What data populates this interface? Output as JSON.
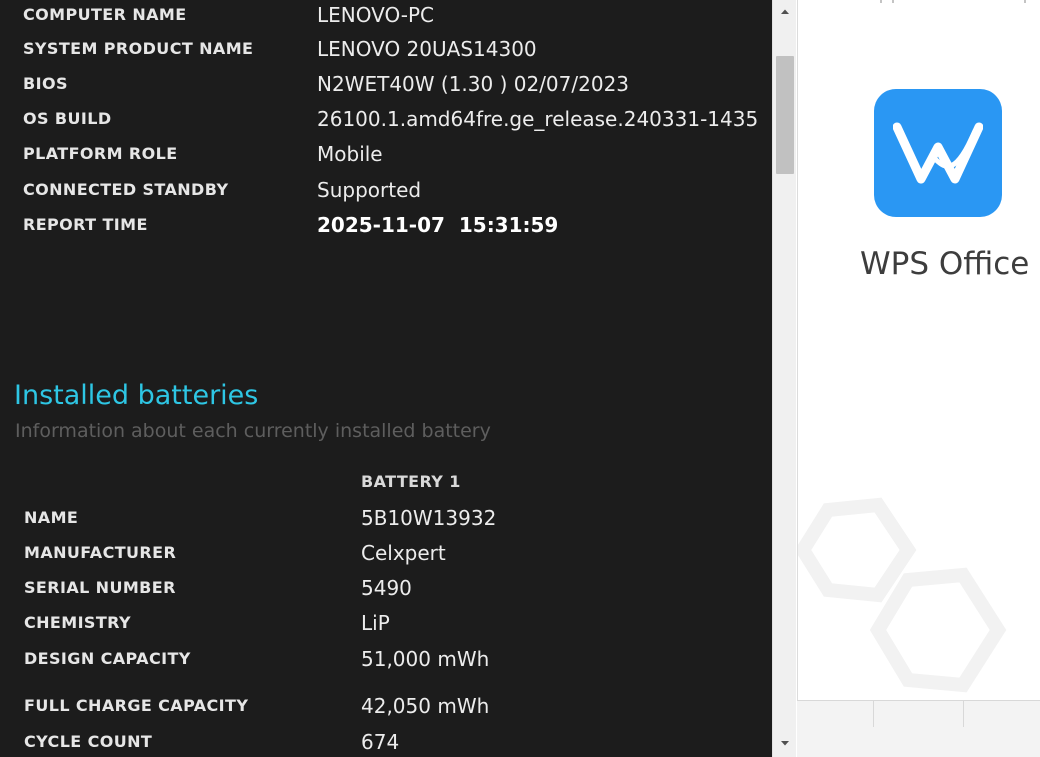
{
  "system_info": [
    {
      "key": "COMPUTER NAME",
      "value": "LENOVO-PC"
    },
    {
      "key": "SYSTEM PRODUCT NAME",
      "value": "LENOVO 20UAS14300"
    },
    {
      "key": "BIOS",
      "value": "N2WET40W (1.30 ) 02/07/2023"
    },
    {
      "key": "OS BUILD",
      "value": "26100.1.amd64fre.ge_release.240331-1435"
    },
    {
      "key": "PLATFORM ROLE",
      "value": "Mobile"
    },
    {
      "key": "CONNECTED STANDBY",
      "value": "Supported"
    },
    {
      "key": "REPORT TIME",
      "value": "2025-11-07  15:31:59"
    }
  ],
  "batteries_section": {
    "title": "Installed batteries",
    "subtitle": "Information about each currently installed battery",
    "column_header": "BATTERY 1",
    "rows": [
      {
        "key": "NAME",
        "value": "5B10W13932"
      },
      {
        "key": "MANUFACTURER",
        "value": "Celxpert"
      },
      {
        "key": "SERIAL NUMBER",
        "value": "5490"
      },
      {
        "key": "CHEMISTRY",
        "value": "LiP"
      },
      {
        "key": "DESIGN CAPACITY",
        "value": "51,000 mWh"
      },
      {
        "key": "FULL CHARGE CAPACITY",
        "value": "42,050 mWh"
      },
      {
        "key": "CYCLE COUNT",
        "value": "674"
      }
    ]
  },
  "wps": {
    "app_name": "WPS Office",
    "icon": "wps-logo-icon",
    "brand_color": "#2A97F3"
  },
  "colors": {
    "report_bg": "#1C1C1C",
    "section_title": "#2EC6E4"
  }
}
